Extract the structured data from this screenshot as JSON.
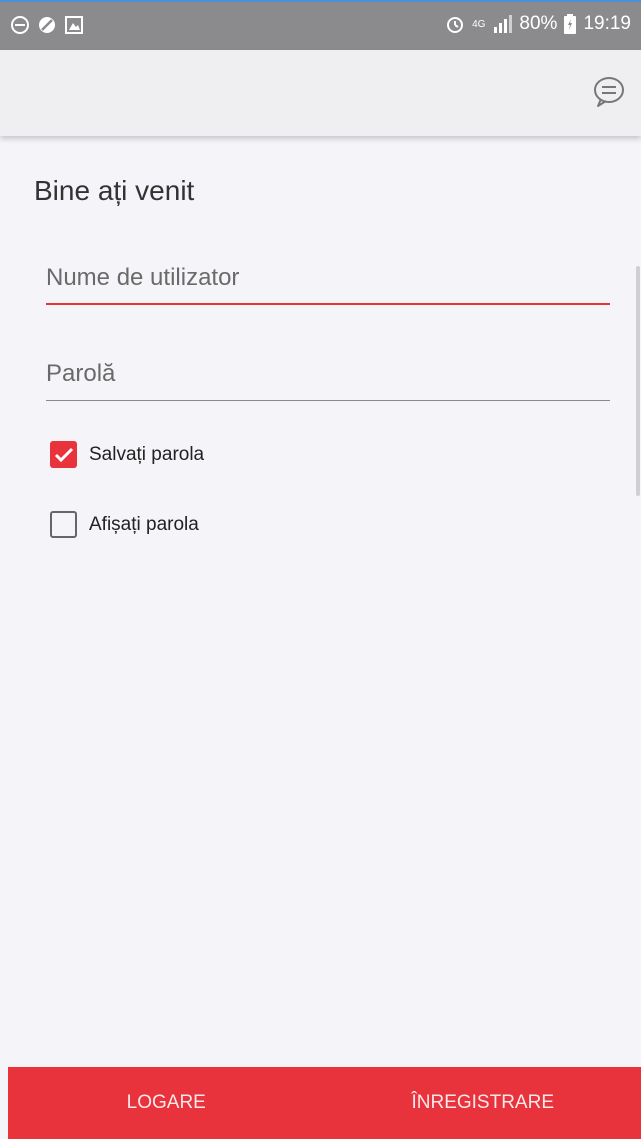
{
  "status_bar": {
    "battery": "80%",
    "time": "19:19",
    "network": "4G",
    "icons": [
      "dnd-icon",
      "blocked-icon",
      "image-icon",
      "alarm-icon",
      "network-icon",
      "signal-icon",
      "battery-icon"
    ]
  },
  "app_bar": {
    "chat_icon": "chat-bubble-icon"
  },
  "login": {
    "title": "Bine ați venit",
    "username_placeholder": "Nume de utilizator",
    "username_value": "",
    "password_placeholder": "Parolă",
    "password_value": "",
    "save_password_label": "Salvați parola",
    "save_password_checked": true,
    "show_password_label": "Afișați parola",
    "show_password_checked": false
  },
  "bottom_bar": {
    "login_label": "LOGARE",
    "register_label": "ÎNREGISTRARE"
  },
  "colors": {
    "accent": "#e8323c",
    "status_bar": "#8b8b8e",
    "background": "#f5f4f8"
  }
}
